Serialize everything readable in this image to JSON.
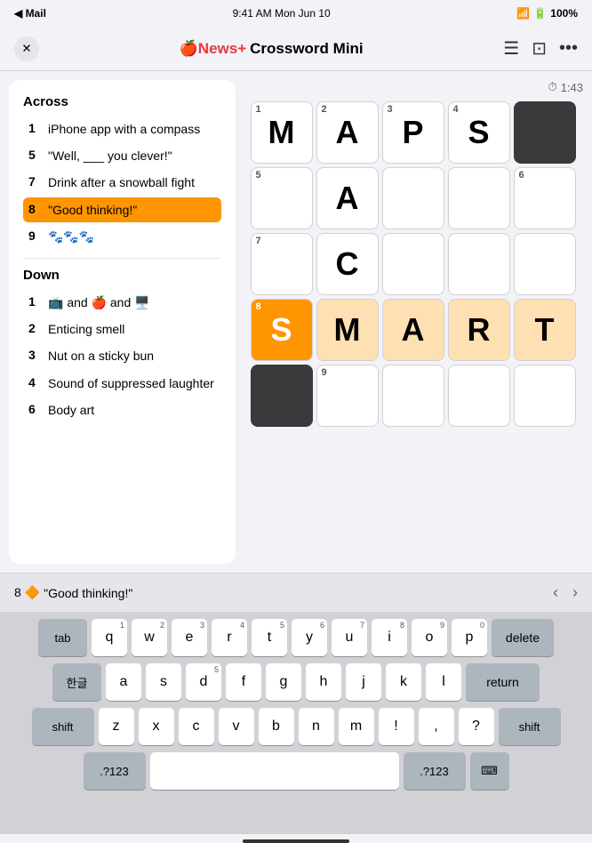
{
  "statusBar": {
    "left": "◀ Mail",
    "center": "9:41 AM  Mon Jun 10",
    "battery": "100%",
    "wifi": "WiFi",
    "signal": "●●●"
  },
  "navBar": {
    "title": "Crossword Mini",
    "appleNewsPlus": "News+",
    "closeLabel": "✕"
  },
  "timer": {
    "label": "1:43",
    "icon": "⏱"
  },
  "clues": {
    "acrossTitle": "Across",
    "acrossItems": [
      {
        "num": "1",
        "text": "iPhone app with a compass"
      },
      {
        "num": "5",
        "text": "\"Well, ___ you clever!\""
      },
      {
        "num": "7",
        "text": "Drink after a snowball fight"
      },
      {
        "num": "8",
        "text": "\"Good thinking!\"",
        "active": true
      },
      {
        "num": "9",
        "text": "🐾🐾🐾"
      }
    ],
    "downTitle": "Down",
    "downItems": [
      {
        "num": "1",
        "text": "📺 and 🍎 and 🖥️"
      },
      {
        "num": "2",
        "text": "Enticing smell"
      },
      {
        "num": "3",
        "text": "Nut on a sticky bun"
      },
      {
        "num": "4",
        "text": "Sound of suppressed laughter"
      },
      {
        "num": "6",
        "text": "Body art"
      }
    ]
  },
  "grid": {
    "cells": [
      {
        "row": 1,
        "col": 1,
        "num": "1",
        "letter": "M",
        "state": "normal"
      },
      {
        "row": 1,
        "col": 2,
        "num": "2",
        "letter": "A",
        "state": "normal"
      },
      {
        "row": 1,
        "col": 3,
        "num": "3",
        "letter": "P",
        "state": "normal"
      },
      {
        "row": 1,
        "col": 4,
        "num": "4",
        "letter": "S",
        "state": "normal"
      },
      {
        "row": 1,
        "col": 5,
        "num": "",
        "letter": "",
        "state": "black"
      },
      {
        "row": 2,
        "col": 1,
        "num": "5",
        "letter": "",
        "state": "normal"
      },
      {
        "row": 2,
        "col": 2,
        "num": "",
        "letter": "A",
        "state": "normal"
      },
      {
        "row": 2,
        "col": 3,
        "num": "",
        "letter": "",
        "state": "normal"
      },
      {
        "row": 2,
        "col": 4,
        "num": "",
        "letter": "",
        "state": "normal"
      },
      {
        "row": 2,
        "col": 5,
        "num": "6",
        "letter": "",
        "state": "normal"
      },
      {
        "row": 3,
        "col": 1,
        "num": "7",
        "letter": "",
        "state": "normal"
      },
      {
        "row": 3,
        "col": 2,
        "num": "",
        "letter": "C",
        "state": "normal"
      },
      {
        "row": 3,
        "col": 3,
        "num": "",
        "letter": "",
        "state": "normal"
      },
      {
        "row": 3,
        "col": 4,
        "num": "",
        "letter": "",
        "state": "normal"
      },
      {
        "row": 3,
        "col": 5,
        "num": "",
        "letter": "",
        "state": "normal"
      },
      {
        "row": 4,
        "col": 1,
        "num": "8",
        "letter": "S",
        "state": "active-orange"
      },
      {
        "row": 4,
        "col": 2,
        "num": "",
        "letter": "M",
        "state": "highlighted"
      },
      {
        "row": 4,
        "col": 3,
        "num": "",
        "letter": "A",
        "state": "highlighted"
      },
      {
        "row": 4,
        "col": 4,
        "num": "",
        "letter": "R",
        "state": "highlighted"
      },
      {
        "row": 4,
        "col": 5,
        "num": "",
        "letter": "T",
        "state": "highlighted"
      },
      {
        "row": 5,
        "col": 1,
        "num": "",
        "letter": "",
        "state": "black"
      },
      {
        "row": 5,
        "col": 2,
        "num": "9",
        "letter": "",
        "state": "normal"
      },
      {
        "row": 5,
        "col": 3,
        "num": "",
        "letter": "",
        "state": "normal"
      },
      {
        "row": 5,
        "col": 4,
        "num": "",
        "letter": "",
        "state": "normal"
      },
      {
        "row": 5,
        "col": 5,
        "num": "",
        "letter": "",
        "state": "normal"
      }
    ]
  },
  "clueBar": {
    "clueNum": "8",
    "icon": "🔶",
    "clueText": "\"Good thinking!\""
  },
  "keyboard": {
    "rows": [
      [
        "tab",
        "q",
        "w",
        "e",
        "r",
        "t",
        "y",
        "u",
        "i",
        "o",
        "p",
        "delete"
      ],
      [
        "한글",
        "a",
        "s",
        "d",
        "f",
        "g",
        "h",
        "j",
        "k",
        "l",
        "return"
      ],
      [
        "shift",
        "z",
        "x",
        "c",
        "v",
        "b",
        "n",
        "m",
        "!",
        ",",
        "?",
        "shift"
      ],
      [
        ".?123",
        "space",
        ".?123",
        "⌨️"
      ]
    ],
    "keyNums": {
      "q": "1",
      "w": "2",
      "e": "3",
      "r": "4",
      "t": "5",
      "y": "6",
      "u": "7",
      "i": "8",
      "o": "9",
      "p": "0",
      "a": "",
      "s": "",
      "d": "5",
      "f": "",
      "g": "",
      "h": "",
      "j": "",
      "k": "",
      "l": "",
      "z": "",
      "x": "",
      "c": "",
      "v": "",
      "b": "",
      "n": "",
      "m": ""
    }
  }
}
